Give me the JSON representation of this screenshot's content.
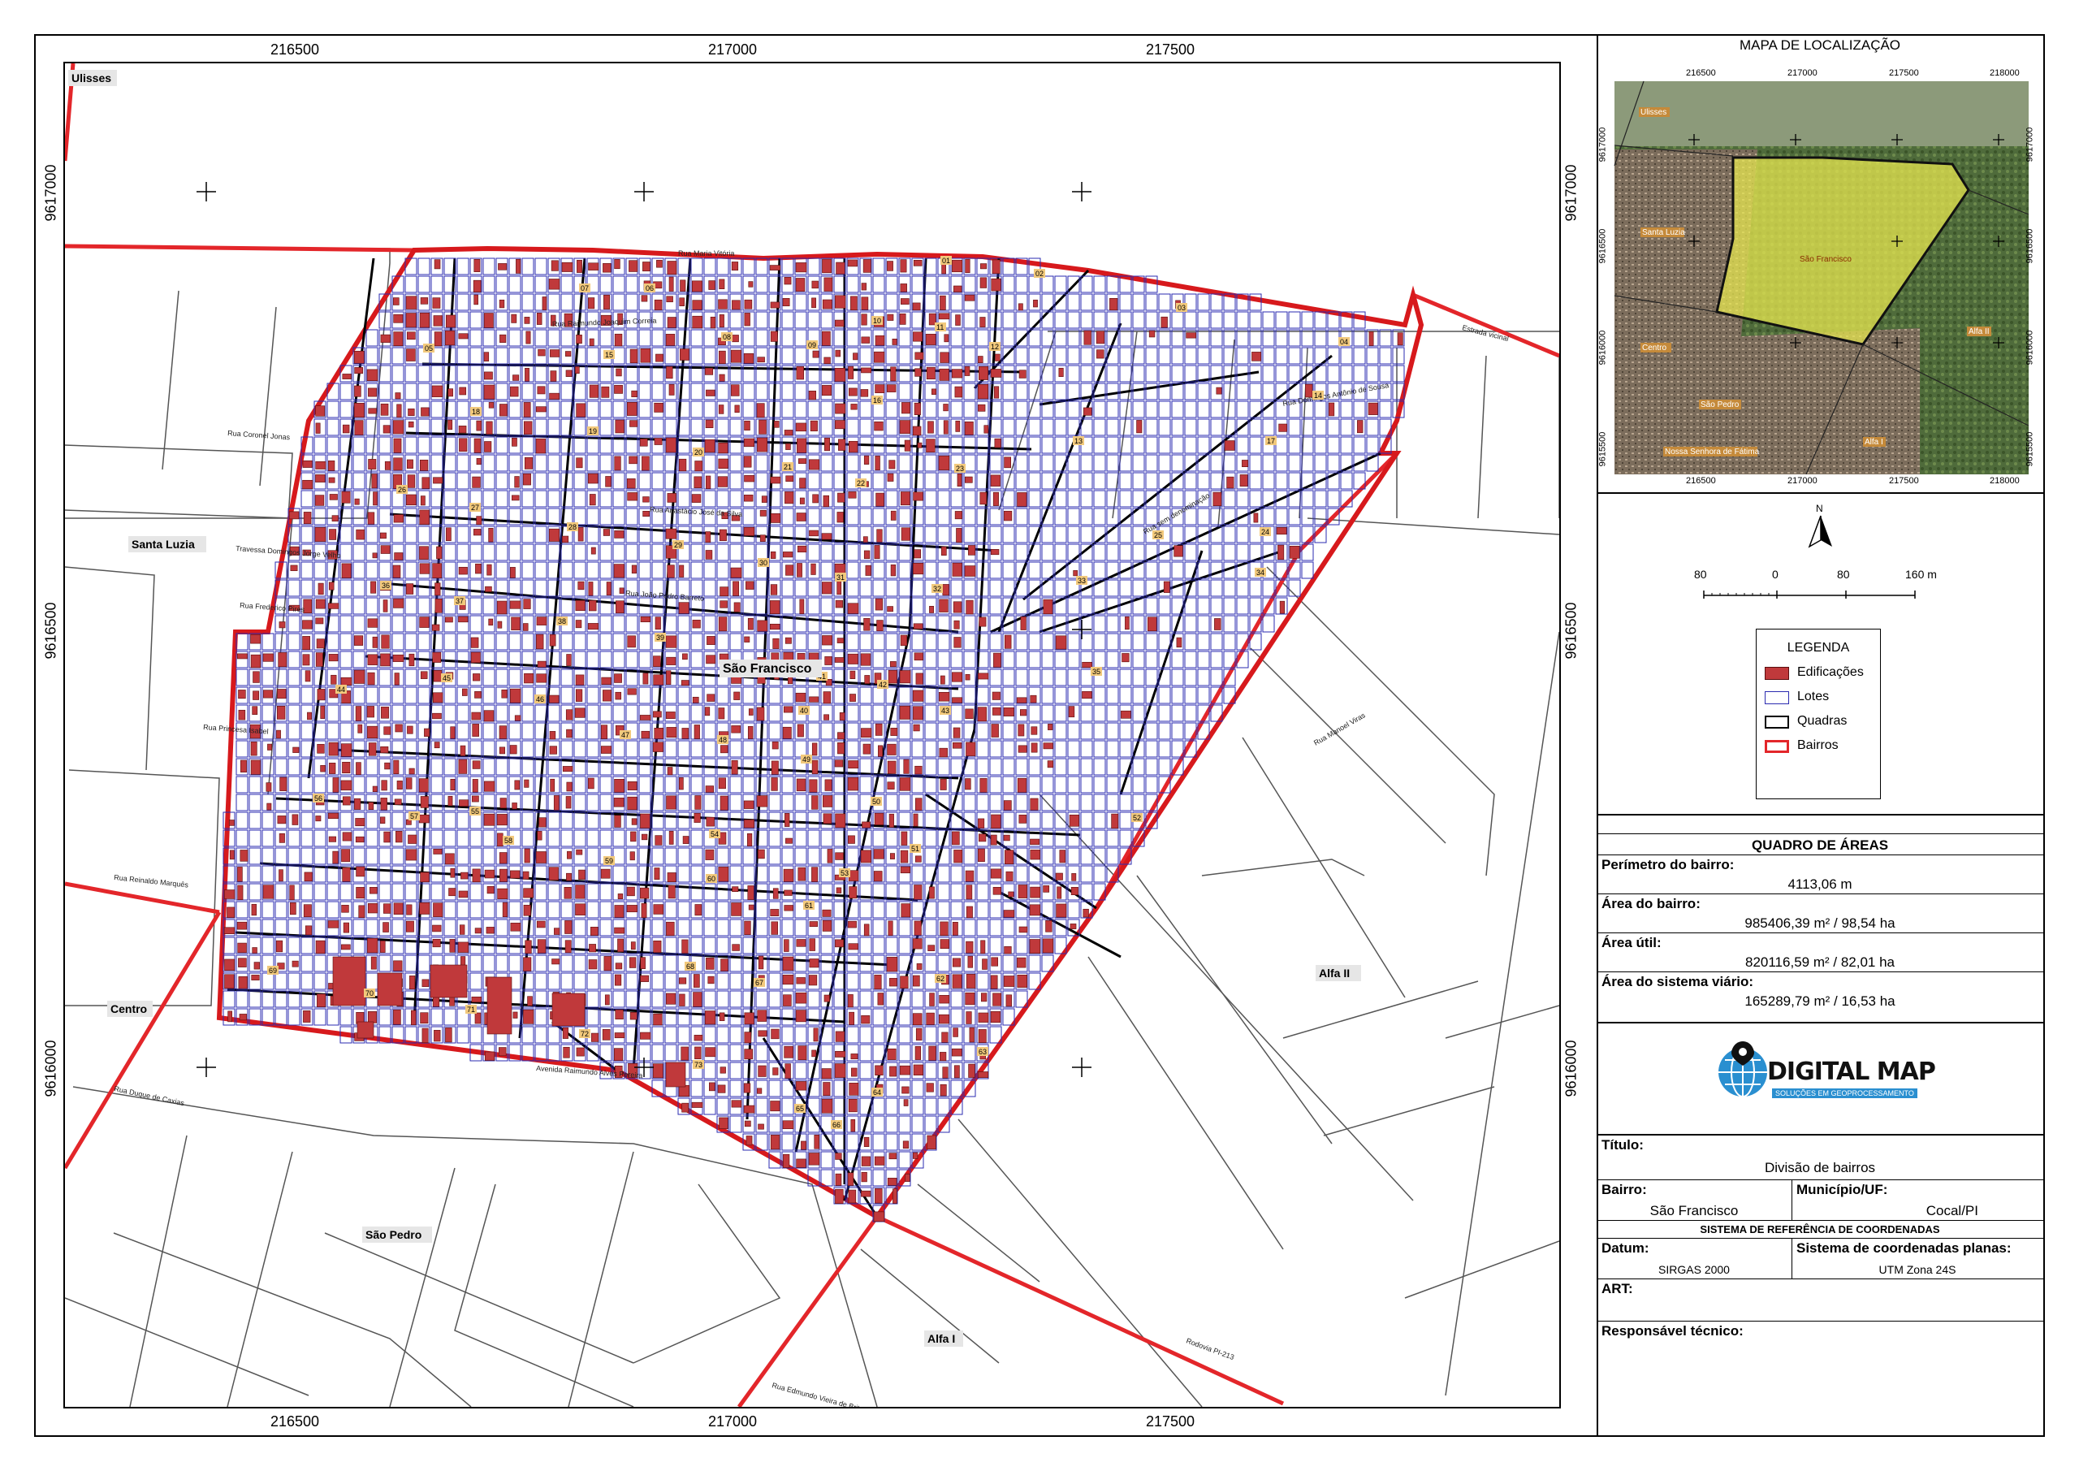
{
  "map": {
    "top_ticks": [
      "216500",
      "217000",
      "217500"
    ],
    "bottom_ticks": [
      "216500",
      "217000",
      "217500"
    ],
    "left_ticks": [
      "9617000",
      "9616500",
      "9616000"
    ],
    "right_ticks": [
      "9617000",
      "9616500",
      "9616000"
    ],
    "neighborhoods": [
      "Ulisses",
      "Santa Luzia",
      "Centro",
      "São Pedro",
      "São Francisco",
      "Alfa II",
      "Alfa I"
    ],
    "streets": [
      "Rua Maria Vitória",
      "Estrada vicinal",
      "Rua Coronel Jonas",
      "Travessa Domingos Jorge Velho",
      "Rua Frederico Pires",
      "Rua Princesa Isabel",
      "Rua Reinaldo Marquês",
      "Rua Duque de Caxias",
      "Rua Raimundo Joaquim Correia",
      "Rua Anastácio José da Silva",
      "Rua João Pedro Barreto",
      "Rua Domingos Antônio de Sousa",
      "Avenida Raimundo Alves Pereira",
      "Rua Manoel Viras",
      "Rua sem denominação",
      "Rodovia PI-213",
      "Rua Edmundo Vieira de Brito"
    ],
    "quadras": [
      "01",
      "02",
      "03",
      "04",
      "05",
      "06",
      "07",
      "08",
      "09",
      "10",
      "11",
      "12",
      "13",
      "14",
      "15",
      "16",
      "17",
      "18",
      "19",
      "20",
      "21",
      "22",
      "23",
      "24",
      "25",
      "26",
      "27",
      "28",
      "29",
      "30",
      "31",
      "32",
      "33",
      "34",
      "35",
      "36",
      "37",
      "38",
      "39",
      "40",
      "41",
      "42",
      "43",
      "44",
      "45",
      "46",
      "47",
      "48",
      "49",
      "50",
      "51",
      "52",
      "53",
      "54",
      "55",
      "56",
      "57",
      "58",
      "59",
      "60",
      "61",
      "62",
      "63",
      "64",
      "65",
      "66",
      "67",
      "68",
      "69",
      "70",
      "71",
      "72",
      "73"
    ]
  },
  "locator": {
    "title": "MAPA DE LOCALIZAÇÃO",
    "top_ticks": [
      "216500",
      "217000",
      "217500",
      "218000"
    ],
    "bottom_ticks": [
      "216500",
      "217000",
      "217500",
      "218000"
    ],
    "left_ticks": [
      "9617000",
      "9616500",
      "9616000",
      "9615500"
    ],
    "right_ticks": [
      "9617000",
      "9616500",
      "9616000",
      "9615500"
    ],
    "labels": [
      "Ulisses",
      "Santa Luzia",
      "São Francisco",
      "Centro",
      "São Pedro",
      "Nossa Senhora de Fátima",
      "Alfa II",
      "Alfa I"
    ]
  },
  "north": "N",
  "scale": {
    "labels": [
      "80",
      "0",
      "80",
      "160 m"
    ]
  },
  "legend": {
    "title": "LEGENDA",
    "items": [
      {
        "label": "Edificações",
        "color": "#c0393b"
      },
      {
        "label": "Lotes",
        "color": "#2b2bb0"
      },
      {
        "label": "Quadras",
        "color": "#000000"
      },
      {
        "label": "Bairros",
        "color": "#e3262a"
      }
    ]
  },
  "areas": {
    "title": "QUADRO DE ÁREAS",
    "perimetro_label": "Perímetro do bairro:",
    "perimetro_value": "4113,06 m",
    "area_label": "Área do bairro:",
    "area_value": "985406,39 m² / 98,54 ha",
    "util_label": "Área útil:",
    "util_value": "820116,59 m² / 82,01 ha",
    "viario_label": "Área do sistema viário:",
    "viario_value": "165289,79 m² / 16,53 ha"
  },
  "logo": {
    "name": "DIGITAL MAP",
    "tagline": "SOLUÇÕES EM GEOPROCESSAMENTO"
  },
  "info": {
    "titulo_label": "Título:",
    "titulo_value": "Divisão de bairros",
    "bairro_label": "Bairro:",
    "bairro_value": "São Francisco",
    "municipio_label": "Município/UF:",
    "municipio_value": "Cocal/PI",
    "src_title": "SISTEMA DE REFERÊNCIA DE COORDENADAS",
    "datum_label": "Datum:",
    "datum_value": "SIRGAS 2000",
    "scp_label": "Sistema de coordenadas planas:",
    "scp_value": "UTM Zona 24S",
    "art_label": "ART:",
    "resp_label": "Responsável técnico:"
  }
}
